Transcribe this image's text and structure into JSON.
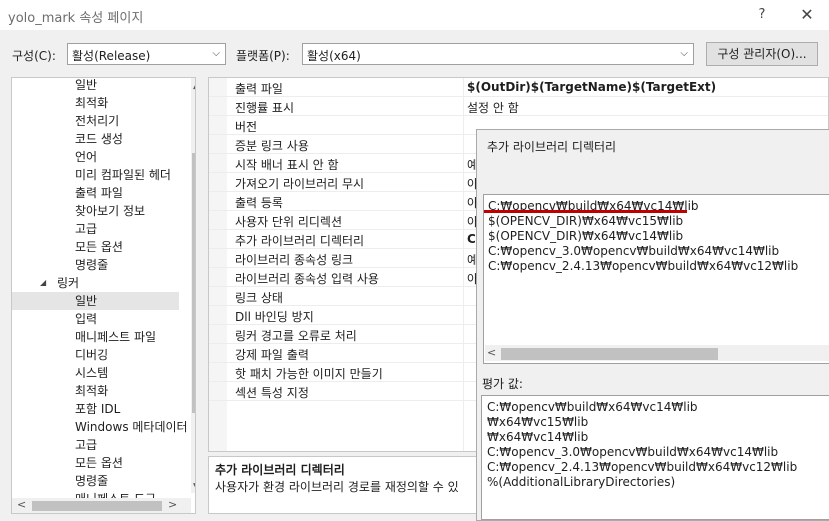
{
  "window": {
    "title": "yolo_mark 속성 페이지",
    "help": "?",
    "close": "✕"
  },
  "config": {
    "config_label": "구성(C):",
    "config_value": "활성(Release)",
    "platform_label": "플랫폼(P):",
    "platform_value": "활성(x64)",
    "manager_button": "구성 관리자(O)..."
  },
  "tree": {
    "items": [
      {
        "label": "일반"
      },
      {
        "label": "최적화"
      },
      {
        "label": "전처리기"
      },
      {
        "label": "코드 생성"
      },
      {
        "label": "언어"
      },
      {
        "label": "미리 컴파일된 헤더"
      },
      {
        "label": "출력 파일"
      },
      {
        "label": "찾아보기 정보"
      },
      {
        "label": "고급"
      },
      {
        "label": "모든 옵션"
      },
      {
        "label": "명령줄"
      },
      {
        "label": "링커",
        "expander": "◢"
      },
      {
        "label": "일반"
      },
      {
        "label": "입력"
      },
      {
        "label": "매니페스트 파일"
      },
      {
        "label": "디버깅"
      },
      {
        "label": "시스템"
      },
      {
        "label": "최적화"
      },
      {
        "label": "포함 IDL"
      },
      {
        "label": "Windows 메타데이터"
      },
      {
        "label": "고급"
      },
      {
        "label": "모든 옵션"
      },
      {
        "label": "명령줄"
      },
      {
        "label": "매니페스트 도구"
      }
    ],
    "scroll_up": "▲",
    "scroll_down": "▼",
    "scroll_left": "<",
    "scroll_right": ">"
  },
  "grid": {
    "rows": [
      {
        "name": "출력 파일",
        "value": "$(OutDir)$(TargetName)$(TargetExt)"
      },
      {
        "name": "진행률 표시",
        "value": "설정 안 함"
      },
      {
        "name": "버전",
        "value": ""
      },
      {
        "name": "증분 링크 사용",
        "value": ""
      },
      {
        "name": "시작 배너 표시 안 함",
        "value": "예"
      },
      {
        "name": "가져오기 라이브러리 무시",
        "value": "아"
      },
      {
        "name": "출력 등록",
        "value": "아"
      },
      {
        "name": "사용자 단위 리디렉션",
        "value": "아"
      },
      {
        "name": "추가 라이브러리 디렉터리",
        "value": "C"
      },
      {
        "name": "라이브러리 종속성 링크",
        "value": "예"
      },
      {
        "name": "라이브러리 종속성 입력 사용",
        "value": "아"
      },
      {
        "name": "링크 상태",
        "value": ""
      },
      {
        "name": "Dll 바인딩 방지",
        "value": ""
      },
      {
        "name": "링커 경고를 오류로 처리",
        "value": ""
      },
      {
        "name": "강제 파일 출력",
        "value": ""
      },
      {
        "name": "핫 패치 가능한 이미지 만들기",
        "value": ""
      },
      {
        "name": "섹션 특성 지정",
        "value": ""
      }
    ]
  },
  "description": {
    "title": "추가 라이브러리 디렉터리",
    "text": "사용자가 환경 라이브러리 경로를 재정의할 수 있"
  },
  "dialog": {
    "title": "추가 라이브러리 디렉터리",
    "list": [
      "C:₩opencv₩build₩x64₩vc14₩lib",
      "$(OPENCV_DIR)₩x64₩vc15₩lib",
      "$(OPENCV_DIR)₩x64₩vc14₩lib",
      "C:₩opencv_3.0₩opencv₩build₩x64₩vc14₩lib",
      "C:₩opencv_2.4.13₩opencv₩build₩x64₩vc12₩lib"
    ],
    "scroll_left": "<",
    "eval_label": "평가 값:",
    "eval_values": [
      "C:₩opencv₩build₩x64₩vc14₩lib",
      "₩x64₩vc15₩lib",
      "₩x64₩vc14₩lib",
      "C:₩opencv_3.0₩opencv₩build₩x64₩vc14₩lib",
      "C:₩opencv_2.4.13₩opencv₩build₩x64₩vc12₩lib",
      "%(AdditionalLibraryDirectories)"
    ],
    "highlight_color": "#c00000"
  }
}
